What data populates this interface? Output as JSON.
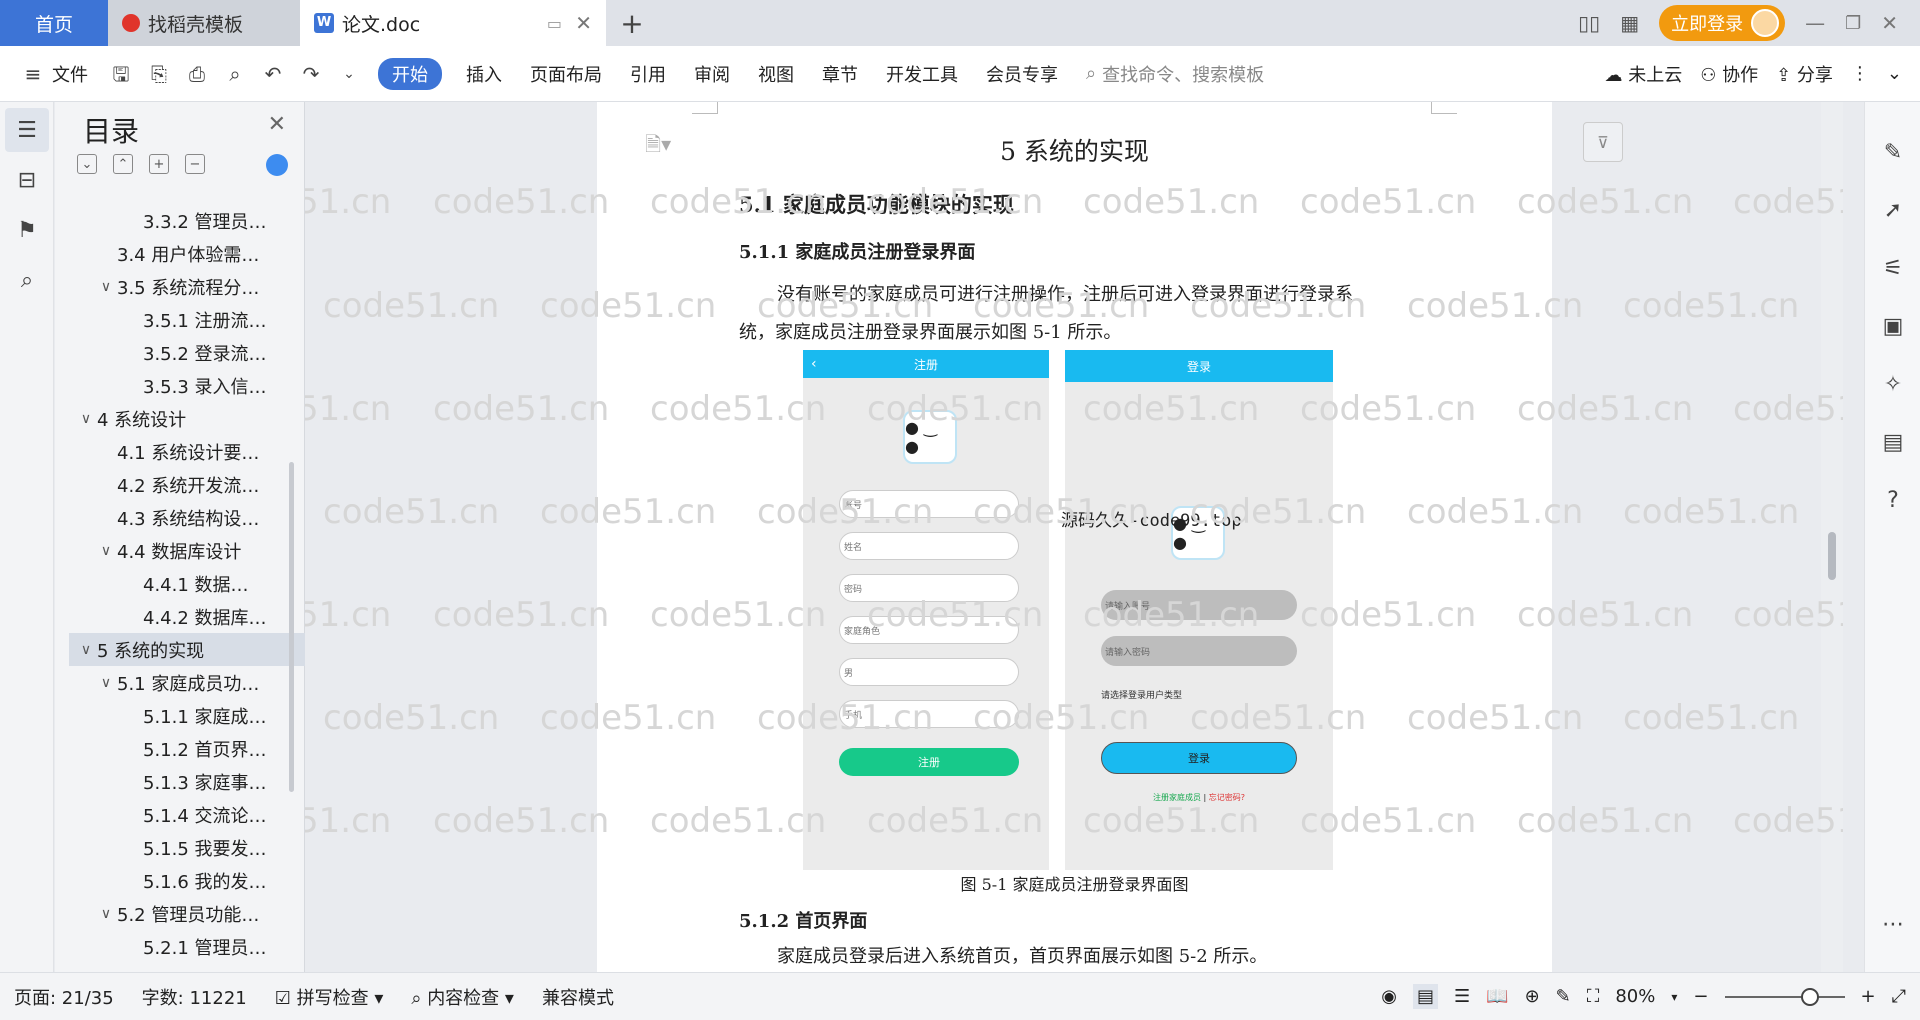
{
  "tabs": {
    "home": "首页",
    "docer": "找稻壳模板",
    "doc": "论文.doc",
    "add": "+",
    "login": "立即登录"
  },
  "toolbar": {
    "file": "文件",
    "items": [
      "开始",
      "插入",
      "页面布局",
      "引用",
      "审阅",
      "视图",
      "章节",
      "开发工具",
      "会员专享"
    ],
    "search_placeholder": "查找命令、搜索模板",
    "cloud": "未上云",
    "collab": "协作",
    "share": "分享"
  },
  "toc": {
    "title": "目录",
    "items": [
      {
        "label": "3.3.2 管理员…",
        "level": 3,
        "chevron": ""
      },
      {
        "label": "3.4 用户体验需…",
        "level": 2,
        "chevron": ""
      },
      {
        "label": "3.5 系统流程分…",
        "level": 2,
        "chevron": "∨"
      },
      {
        "label": "3.5.1 注册流…",
        "level": 3,
        "chevron": ""
      },
      {
        "label": "3.5.2 登录流…",
        "level": 3,
        "chevron": ""
      },
      {
        "label": "3.5.3 录入信…",
        "level": 3,
        "chevron": ""
      },
      {
        "label": "4 系统设计",
        "level": 1,
        "chevron": "∨"
      },
      {
        "label": "4.1 系统设计要…",
        "level": 2,
        "chevron": ""
      },
      {
        "label": "4.2 系统开发流…",
        "level": 2,
        "chevron": ""
      },
      {
        "label": "4.3 系统结构设…",
        "level": 2,
        "chevron": ""
      },
      {
        "label": "4.4 数据库设计",
        "level": 2,
        "chevron": "∨"
      },
      {
        "label": "4.4.1 数据…",
        "level": 3,
        "chevron": ""
      },
      {
        "label": "4.4.2 数据库…",
        "level": 3,
        "chevron": ""
      },
      {
        "label": "5  系统的实现",
        "level": 1,
        "chevron": "∨",
        "active": true
      },
      {
        "label": "5.1 家庭成员功…",
        "level": 2,
        "chevron": "∨"
      },
      {
        "label": "5.1.1 家庭成…",
        "level": 3,
        "chevron": ""
      },
      {
        "label": "5.1.2 首页界…",
        "level": 3,
        "chevron": ""
      },
      {
        "label": "5.1.3 家庭事…",
        "level": 3,
        "chevron": ""
      },
      {
        "label": "5.1.4 交流论…",
        "level": 3,
        "chevron": ""
      },
      {
        "label": "5.1.5 我要发…",
        "level": 3,
        "chevron": ""
      },
      {
        "label": "5.1.6 我的发…",
        "level": 3,
        "chevron": ""
      },
      {
        "label": "5.2 管理员功能…",
        "level": 2,
        "chevron": "∨"
      },
      {
        "label": "5.2.1 管理员…",
        "level": 3,
        "chevron": ""
      }
    ]
  },
  "document": {
    "chapter_title": "5  系统的实现",
    "section_51": "5.1 家庭成员功能模块的实现",
    "section_511": "5.1.1 家庭成员注册登录界面",
    "para_1_line1": "没有账号的家庭成员可进行注册操作，注册后可进入登录界面进行登录系",
    "para_1_line2": "统，家庭成员注册登录界面展示如图 5-1 所示。",
    "figure_caption": "图 5-1   家庭成员注册登录界面图",
    "section_512": "5.1.2 首页界面",
    "para_2": "家庭成员登录后进入系统首页，首页界面展示如图 5-2 所示。",
    "figure": {
      "register_title": "注册",
      "login_title": "登录",
      "register_fields": [
        "账号",
        "姓名",
        "密码",
        "家庭角色",
        "男",
        "手机"
      ],
      "register_button": "注册",
      "login_fields": [
        "请输入账号",
        "请输入密码"
      ],
      "login_role_hint": "请选择登录用户类型",
      "login_button": "登录",
      "login_link_register": "注册家庭成员",
      "login_link_sep": "|",
      "login_link_forgot": "忘记密码?",
      "code_watermark": "源码久久-code99.top"
    },
    "watermark_text": "code51.cn"
  },
  "status": {
    "page": "页面: 21/35",
    "words": "字数: 11221",
    "spell": "拼写检查",
    "content_check": "内容检查",
    "compat": "兼容模式",
    "zoom": "80%",
    "zoom_value": 0.8
  },
  "colors": {
    "accent": "#3d74d6",
    "login": "#f29a0f",
    "app_header": "#19baf0",
    "green_button": "#17c98a"
  }
}
